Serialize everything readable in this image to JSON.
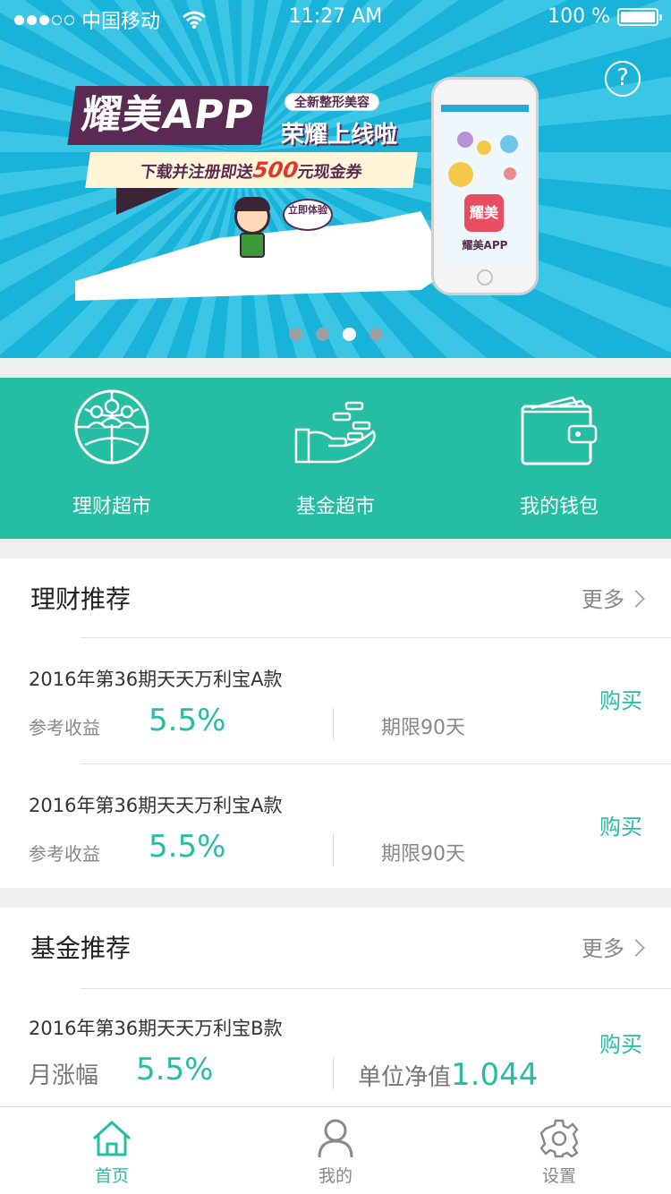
{
  "status_bar": {
    "carrier": "中国移动",
    "time": "11:27 AM",
    "battery": "100 %",
    "battery_level": 1.0
  },
  "banner": {
    "title": "耀美APP",
    "pill": "全新整形美容",
    "title2": "荣耀上线啦",
    "sub_prefix": "下载并注册即送",
    "sub_amount": "500",
    "sub_suffix": "元现金券",
    "bubble": "立即体验",
    "phone_app": "耀美",
    "phone_label": "耀美APP",
    "dots_total": 4,
    "dots_active": 3
  },
  "quick_menu": [
    {
      "label": "理财超市",
      "icon": "globe-people-icon"
    },
    {
      "label": "基金超市",
      "icon": "hand-coins-icon"
    },
    {
      "label": "我的钱包",
      "icon": "wallet-icon"
    }
  ],
  "finance_section": {
    "title": "理财推荐",
    "more": "更多",
    "items": [
      {
        "name": "2016年第36期天天万利宝A款",
        "label": "参考收益",
        "value": "5.5%",
        "right_prefix": "期限90天",
        "right_value": "",
        "buy": "购买"
      },
      {
        "name": "2016年第36期天天万利宝A款",
        "label": "参考收益",
        "value": "5.5%",
        "right_prefix": "期限90天",
        "right_value": "",
        "buy": "购买"
      }
    ]
  },
  "fund_section": {
    "title": "基金推荐",
    "more": "更多",
    "items": [
      {
        "name": "2016年第36期天天万利宝B款",
        "label": "月涨幅",
        "value": "5.5%",
        "right_prefix": "单位净值",
        "right_value": "1.044",
        "buy": "购买"
      }
    ]
  },
  "tabbar": [
    {
      "label": "首页",
      "icon": "home-icon",
      "active": true
    },
    {
      "label": "我的",
      "icon": "user-icon",
      "active": false
    },
    {
      "label": "设置",
      "icon": "gear-icon",
      "active": false
    }
  ],
  "colors": {
    "accent": "#26bea2",
    "banner_bg": "#19b3d9",
    "promo_purple": "#5a2a52"
  }
}
